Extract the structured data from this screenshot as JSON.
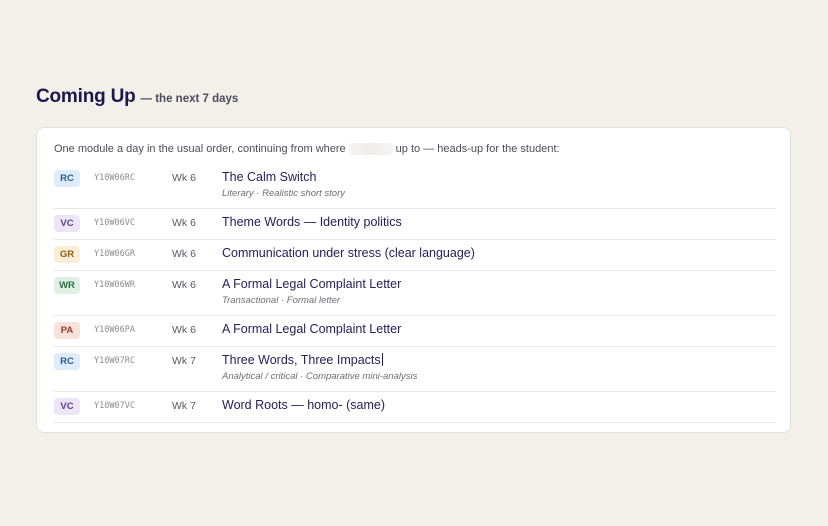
{
  "header": {
    "title": "Coming Up",
    "subtitle": "— the next 7 days"
  },
  "intro": {
    "before": "One module a day in the usual order, continuing from where",
    "after": "up to — heads-up for the student:"
  },
  "colors": {
    "RC": {
      "bg": "#deebf8",
      "fg": "#2b5c8f"
    },
    "VC": {
      "bg": "#ece5f6",
      "fg": "#5e3f8e"
    },
    "GR": {
      "bg": "#fbeed6",
      "fg": "#8a5f17"
    },
    "WR": {
      "bg": "#e0efe3",
      "fg": "#2f6e41"
    },
    "PA": {
      "bg": "#fae2dc",
      "fg": "#9b3e2a"
    }
  },
  "modules": [
    {
      "type": "RC",
      "code": "Y10W06RC",
      "week": "Wk 6",
      "title": "The Calm Switch",
      "meta": "Literary · Realistic short story"
    },
    {
      "type": "VC",
      "code": "Y10W06VC",
      "week": "Wk 6",
      "title": "Theme Words — Identity politics",
      "meta": ""
    },
    {
      "type": "GR",
      "code": "Y10W06GR",
      "week": "Wk 6",
      "title": "Communication under stress (clear language)",
      "meta": ""
    },
    {
      "type": "WR",
      "code": "Y10W06WR",
      "week": "Wk 6",
      "title": "A Formal Legal Complaint Letter",
      "meta": "Transactional · Formal letter"
    },
    {
      "type": "PA",
      "code": "Y10W06PA",
      "week": "Wk 6",
      "title": "A Formal Legal Complaint Letter",
      "meta": ""
    },
    {
      "type": "RC",
      "code": "Y10W07RC",
      "week": "Wk 7",
      "title": "Three Words, Three Impacts",
      "meta": "Analytical / critical · Comparative mini-analysis"
    },
    {
      "type": "VC",
      "code": "Y10W07VC",
      "week": "Wk 7",
      "title": "Word Roots — homo- (same)",
      "meta": ""
    }
  ]
}
